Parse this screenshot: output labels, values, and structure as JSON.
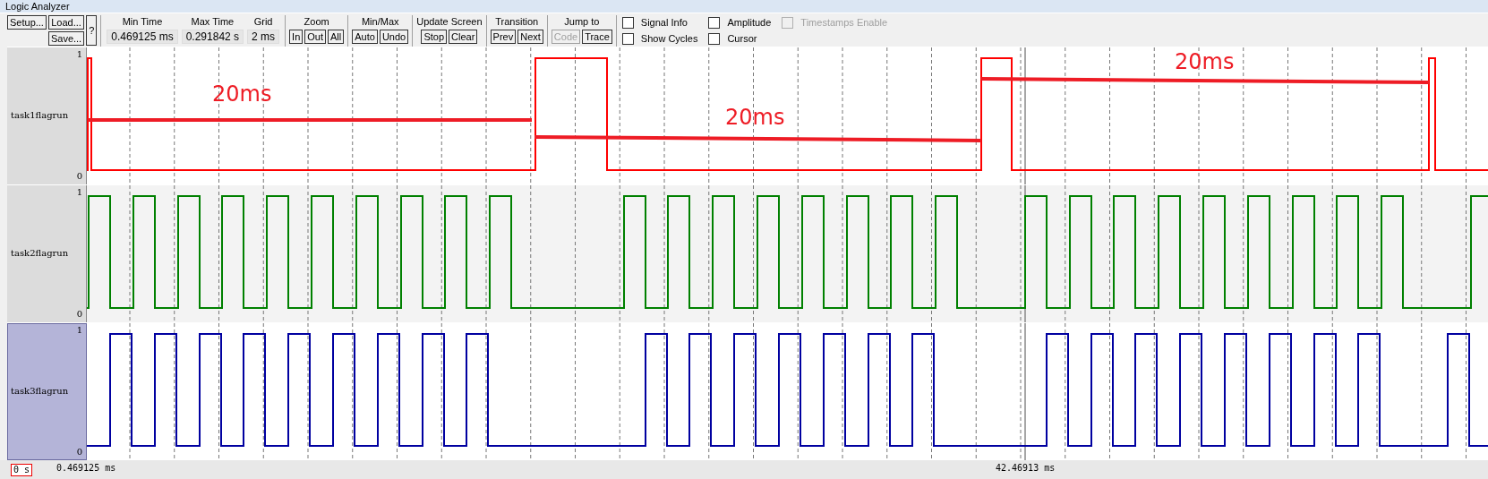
{
  "window": {
    "title": "Logic Analyzer"
  },
  "toolbar": {
    "buttons_left": [
      {
        "label": "Setup..."
      },
      {
        "label": "Load..."
      },
      {
        "label": "Save..."
      },
      {
        "label": "?"
      }
    ],
    "fields": [
      {
        "label": "Min Time",
        "value": "0.469125 ms"
      },
      {
        "label": "Max Time",
        "value": "0.291842 s"
      },
      {
        "label": "Grid",
        "value": "2 ms"
      }
    ],
    "groups": [
      {
        "label": "Zoom",
        "buttons": [
          {
            "label": "In",
            "disabled": false
          },
          {
            "label": "Out",
            "disabled": false
          },
          {
            "label": "All",
            "disabled": false
          }
        ]
      },
      {
        "label": "Min/Max",
        "buttons": [
          {
            "label": "Auto",
            "disabled": false
          },
          {
            "label": "Undo",
            "disabled": false
          }
        ]
      },
      {
        "label": "Update Screen",
        "buttons": [
          {
            "label": "Stop",
            "disabled": false
          },
          {
            "label": "Clear",
            "disabled": false
          }
        ]
      },
      {
        "label": "Transition",
        "buttons": [
          {
            "label": "Prev",
            "disabled": false
          },
          {
            "label": "Next",
            "disabled": false
          }
        ]
      },
      {
        "label": "Jump to",
        "buttons": [
          {
            "label": "Code",
            "disabled": true
          },
          {
            "label": "Trace",
            "disabled": false
          }
        ]
      }
    ],
    "checkboxes": [
      {
        "label": "Signal Info",
        "checked": false,
        "disabled": false
      },
      {
        "label": "Show Cycles",
        "checked": false,
        "disabled": false
      },
      {
        "label": "Amplitude",
        "checked": false,
        "disabled": false
      },
      {
        "label": "Cursor",
        "checked": false,
        "disabled": false
      },
      {
        "label": "Timestamps Enable",
        "checked": false,
        "disabled": true
      }
    ]
  },
  "signals": [
    {
      "name": "task1flagrun",
      "max": "1",
      "min": "0",
      "color": "#ff0000",
      "selected": false
    },
    {
      "name": "task2flagrun",
      "max": "1",
      "min": "0",
      "color": "#008000",
      "selected": false
    },
    {
      "name": "task3flagrun",
      "max": "1",
      "min": "0",
      "color": "#0000a0",
      "selected": true
    }
  ],
  "annotations": [
    {
      "text": "20ms"
    },
    {
      "text": "20ms"
    },
    {
      "text": "20ms"
    }
  ],
  "status_bar": {
    "origin": "0 s",
    "left_time": "0.469125 ms",
    "cursor_time": "42.46913 ms"
  }
}
